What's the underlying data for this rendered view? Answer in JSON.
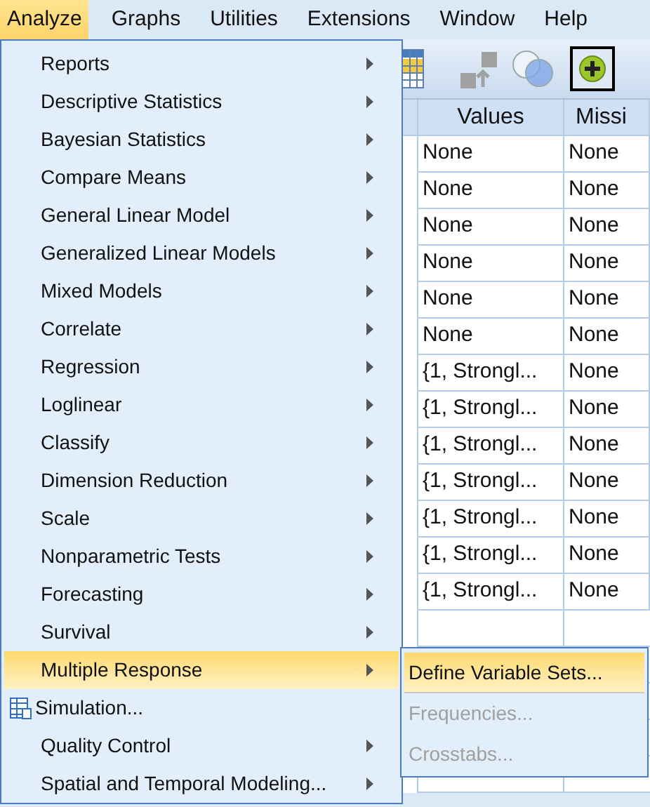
{
  "menubar": [
    {
      "label": "Analyze",
      "selected": true
    },
    {
      "label": "Graphs",
      "selected": false
    },
    {
      "label": "Utilities",
      "selected": false
    },
    {
      "label": "Extensions",
      "selected": false
    },
    {
      "label": "Window",
      "selected": false
    },
    {
      "label": "Help",
      "selected": false
    }
  ],
  "table": {
    "columns": [
      "Values",
      "Missi"
    ],
    "rows": [
      [
        "None",
        "None"
      ],
      [
        "None",
        "None"
      ],
      [
        "None",
        "None"
      ],
      [
        "None",
        "None"
      ],
      [
        "None",
        "None"
      ],
      [
        "None",
        "None"
      ],
      [
        "{1, Strongl...",
        "None"
      ],
      [
        "{1, Strongl...",
        "None"
      ],
      [
        "{1, Strongl...",
        "None"
      ],
      [
        "{1, Strongl...",
        "None"
      ],
      [
        "{1, Strongl...",
        "None"
      ],
      [
        "{1, Strongl...",
        "None"
      ],
      [
        "{1, Strongl...",
        "None"
      ]
    ]
  },
  "menu": {
    "items": [
      {
        "label": "Reports",
        "kind": "submenu",
        "selected": false
      },
      {
        "label": "Descriptive Statistics",
        "kind": "submenu",
        "selected": false
      },
      {
        "label": "Bayesian Statistics",
        "kind": "submenu",
        "selected": false
      },
      {
        "label": "Compare Means",
        "kind": "submenu",
        "selected": false
      },
      {
        "label": "General Linear Model",
        "kind": "submenu",
        "selected": false
      },
      {
        "label": "Generalized Linear Models",
        "kind": "submenu",
        "selected": false
      },
      {
        "label": "Mixed Models",
        "kind": "submenu",
        "selected": false
      },
      {
        "label": "Correlate",
        "kind": "submenu",
        "selected": false
      },
      {
        "label": "Regression",
        "kind": "submenu",
        "selected": false
      },
      {
        "label": "Loglinear",
        "kind": "submenu",
        "selected": false
      },
      {
        "label": "Classify",
        "kind": "submenu",
        "selected": false
      },
      {
        "label": "Dimension Reduction",
        "kind": "submenu",
        "selected": false
      },
      {
        "label": "Scale",
        "kind": "submenu",
        "selected": false
      },
      {
        "label": "Nonparametric Tests",
        "kind": "submenu",
        "selected": false
      },
      {
        "label": "Forecasting",
        "kind": "submenu",
        "selected": false
      },
      {
        "label": "Survival",
        "kind": "submenu",
        "selected": false
      },
      {
        "label": "Multiple Response",
        "kind": "submenu",
        "selected": true
      },
      {
        "label": "Simulation...",
        "kind": "action",
        "selected": false
      },
      {
        "label": "Quality Control",
        "kind": "submenu",
        "selected": false
      },
      {
        "label": "Spatial and Temporal Modeling...",
        "kind": "submenu",
        "selected": false
      }
    ]
  },
  "submenu": {
    "items": [
      {
        "label": "Define Variable Sets...",
        "selected": true,
        "disabled": false
      },
      {
        "label": "Frequencies...",
        "selected": false,
        "disabled": true
      },
      {
        "label": "Crosstabs...",
        "selected": false,
        "disabled": true
      }
    ]
  }
}
